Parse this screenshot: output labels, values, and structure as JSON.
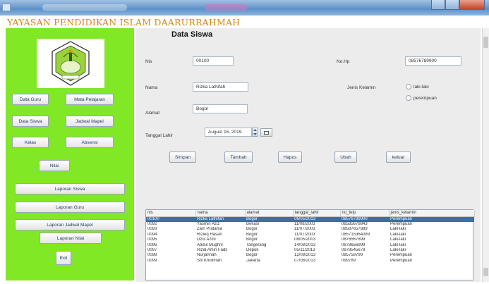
{
  "header": {
    "org_title": "YAYASAN PENDIDIKAN ISLAM DAARURRAHMAH"
  },
  "sidebar": {
    "buttons": {
      "data_guru": "Data Guru",
      "mata_pelajaran": "Mata Pelajaran",
      "data_siswa": "Data Siswa",
      "jadwal_mapel": "Jadwal Mapel",
      "kelas": "Kelas",
      "absensi": "Absensi",
      "nilai": "Nilai",
      "laporan_siswa": "Laporan Siswa",
      "laporan_guru": "Laporan Guru",
      "laporan_jadwal_mapel": "Laporan Jadwal Mapel",
      "laporan_nilai": "Laporan Nilai",
      "exit": "Exit"
    }
  },
  "form": {
    "title": "Data Siswa",
    "nis": {
      "label": "Nis",
      "value": "00100"
    },
    "nama": {
      "label": "Nama",
      "value": "Rizka Lathifah"
    },
    "alamat": {
      "label": "Alamat",
      "value": "Bogor"
    },
    "tanggal_lahir": {
      "label": "Tanggal Lahir",
      "value": "August 16, 2019"
    },
    "no_hp": {
      "label": "No.Hp",
      "value": "08576789900"
    },
    "jenis_kelamin": {
      "label": "Jenis Kelamin",
      "options": [
        "laki-laki",
        "perempuan"
      ]
    }
  },
  "actions": {
    "simpan": "Simpan",
    "tambah": "Tambah",
    "hapus": "Hapus",
    "ubah": "Ubah",
    "keluar": "keluar"
  },
  "table": {
    "columns": [
      "nis",
      "nama",
      "alamat",
      "tanggal_lahir",
      "no_telp",
      "jenis_kelamin"
    ],
    "rows": [
      [
        "00100",
        "Rizka Lathifah",
        "Bogor",
        "06/05/2013",
        "08576789900",
        "Perempuan"
      ],
      [
        "0092",
        "Yasmin Aziz",
        "Bekasi",
        "11/08/2003",
        "08585678843",
        "Perempuan"
      ],
      [
        "0093",
        "Zain Pratama",
        "Bogor",
        "11/07/2003",
        "08587657889",
        "Laki-laki"
      ],
      [
        "0094",
        "Rizieq Hasan",
        "Bogor",
        "11/07/2003",
        "085715364089",
        "Laki-laki"
      ],
      [
        "0095",
        "Dzul Azmi",
        "Bogor",
        "08/05/2003",
        "0876567899",
        "Laki-laki"
      ],
      [
        "0096",
        "Abdul Mughni",
        "Tangerang",
        "14/08/2013",
        "0878656999",
        "Laki-laki"
      ],
      [
        "0097",
        "Rizal Amin Fadli",
        "Depok",
        "05/11/2013",
        "0878545678",
        "Laki-laki"
      ],
      [
        "0098",
        "Nurjannah",
        "Bogor",
        "12/08/2013",
        "085758799",
        "Perempuan"
      ],
      [
        "0099",
        "Siti Kholimah",
        "Jakarta",
        "07/08/2013",
        "099789",
        "Perempuan"
      ]
    ]
  },
  "colors": {
    "sidebar_bg": "#80e824",
    "title_orange": "#d48a0a",
    "selected_row": "#3d6fa6"
  },
  "icons": [
    "app-icon",
    "school-logo",
    "calendar-icon",
    "spinner-icon"
  ]
}
